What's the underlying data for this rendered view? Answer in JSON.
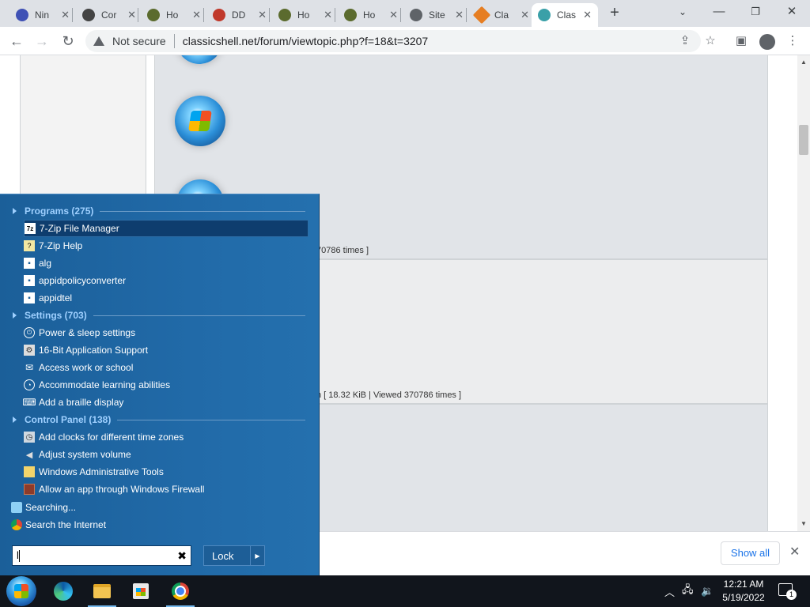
{
  "browser": {
    "tabs": [
      {
        "label": "Nin",
        "color": "#3f51b5"
      },
      {
        "label": "Cor",
        "color": "#444444"
      },
      {
        "label": "Ho",
        "color": "#5b6b2e"
      },
      {
        "label": "DD",
        "color": "#c0392b"
      },
      {
        "label": "Ho",
        "color": "#5b6b2e"
      },
      {
        "label": "Ho",
        "color": "#5b6b2e"
      },
      {
        "label": "Site",
        "color": "#5f6368"
      },
      {
        "label": "Cla",
        "color": "#e67e22"
      },
      {
        "label": "Clas",
        "color": "#3aa0a8"
      }
    ],
    "new_tab": "+",
    "address": {
      "security": "Not secure",
      "url": "classicshell.net/forum/viewtopic.php?f=18&t=3207"
    }
  },
  "page": {
    "attach_1": "70786 times ]",
    "attach_2": "n [ 18.32 KiB | Viewed 370786 times ]"
  },
  "download_bar": {
    "show_all": "Show all"
  },
  "start_menu": {
    "categories": [
      {
        "label": "Programs (275)"
      },
      {
        "label": "Settings (703)"
      },
      {
        "label": "Control Panel (138)"
      }
    ],
    "programs": [
      {
        "label": "7-Zip File Manager",
        "icon": "7zip-icon"
      },
      {
        "label": "7-Zip Help",
        "icon": "help-file-icon"
      },
      {
        "label": "alg",
        "icon": "app-window-icon"
      },
      {
        "label": "appidpolicyconverter",
        "icon": "app-window-icon"
      },
      {
        "label": "appidtel",
        "icon": "app-window-icon"
      }
    ],
    "settings": [
      {
        "label": "Power & sleep settings",
        "icon": "power-icon"
      },
      {
        "label": "16-Bit Application Support",
        "icon": "settings-gear-icon"
      },
      {
        "label": "Access work or school",
        "icon": "briefcase-icon"
      },
      {
        "label": "Accommodate learning abilities",
        "icon": "ease-of-access-icon"
      },
      {
        "label": "Add a braille display",
        "icon": "braille-icon"
      }
    ],
    "control_panel": [
      {
        "label": "Add clocks for different time zones",
        "icon": "clock-icon"
      },
      {
        "label": "Adjust system volume",
        "icon": "speaker-icon"
      },
      {
        "label": "Windows Administrative Tools",
        "icon": "folder-icon"
      },
      {
        "label": "Allow an app through Windows Firewall",
        "icon": "firewall-icon"
      }
    ],
    "searching": "Searching...",
    "search_internet": "Search the Internet",
    "search_value": "l",
    "lock": "Lock"
  },
  "taskbar": {
    "time": "12:21 AM",
    "date": "5/19/2022",
    "notification_count": "1"
  }
}
